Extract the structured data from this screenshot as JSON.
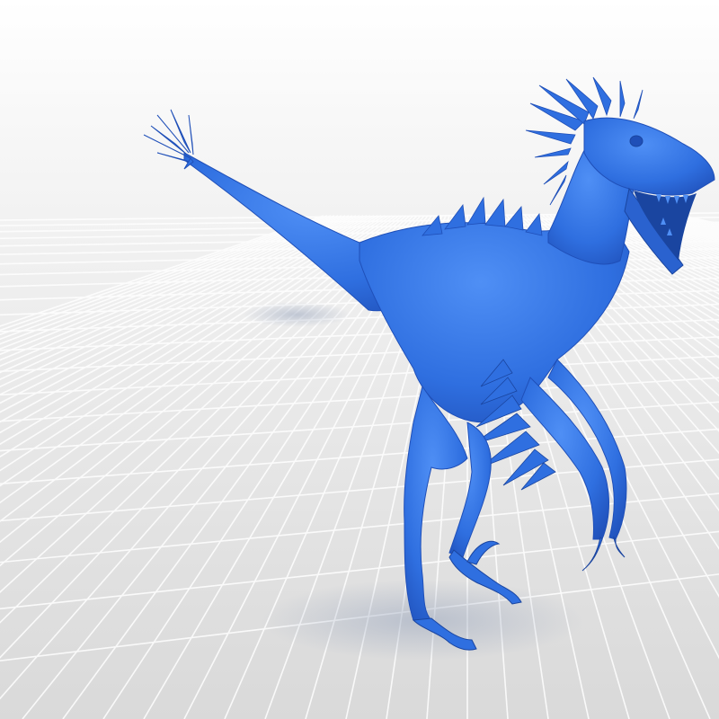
{
  "scene": {
    "subject": "raptor-model",
    "colors": {
      "background_top": "#ffffff",
      "background_bottom": "#d9d9d9",
      "grid_line": "#ffffff",
      "floor_shade": "#cfcfcf",
      "model_base": "#2f6fe0",
      "model_light": "#4f8ff5",
      "model_dark": "#1f4fb8",
      "model_shadow": "#1a45a0"
    }
  }
}
